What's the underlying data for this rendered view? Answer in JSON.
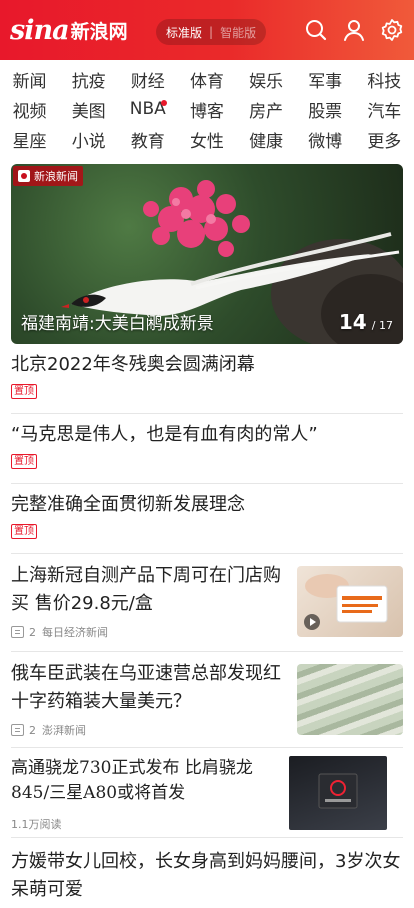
{
  "header": {
    "logo_sina": "sina",
    "logo_cn": "新浪网",
    "edition_standard": "标准版",
    "edition_separator": "|",
    "edition_smart": "智能版",
    "icons": [
      "search-icon",
      "user-icon",
      "settings-icon"
    ],
    "brand_color": "#e8182b"
  },
  "nav": {
    "rows": [
      [
        "新闻",
        "抗疫",
        "财经",
        "体育",
        "娱乐",
        "军事",
        "科技"
      ],
      [
        "视频",
        "美图",
        "NBA",
        "博客",
        "房产",
        "股票",
        "汽车"
      ],
      [
        "星座",
        "小说",
        "教育",
        "女性",
        "健康",
        "微博",
        "更多"
      ]
    ]
  },
  "hero": {
    "badge": "新浪新闻",
    "title": "福建南靖:大美白鹇成新景",
    "current": "14",
    "total": "/ 17"
  },
  "feed": [
    {
      "title": "北京2022年冬残奥会圆满闭幕",
      "tag": "置顶"
    },
    {
      "title": "“马克思是伟人，也是有血有肉的常人”",
      "tag": "置顶"
    },
    {
      "title": "完整准确全面贯彻新发展理念",
      "tag": "置顶"
    },
    {
      "title": "上海新冠自测产品下周可在门店购买 售价29.8元/盒",
      "comments": "2",
      "source": "每日经济新闻"
    },
    {
      "title": "俄车臣武装在乌亚速营总部发现红十字药箱装大量美元？",
      "comments": "2",
      "source": "澎湃新闻"
    },
    {
      "title": "高通骁龙730正式发布 比肩骁龙845/三星A80或将首发",
      "reads": "1.1万阅读"
    },
    {
      "title": "方媛带女儿回校，长女身高到妈妈腰间，3岁次女呆萌可爱"
    }
  ]
}
